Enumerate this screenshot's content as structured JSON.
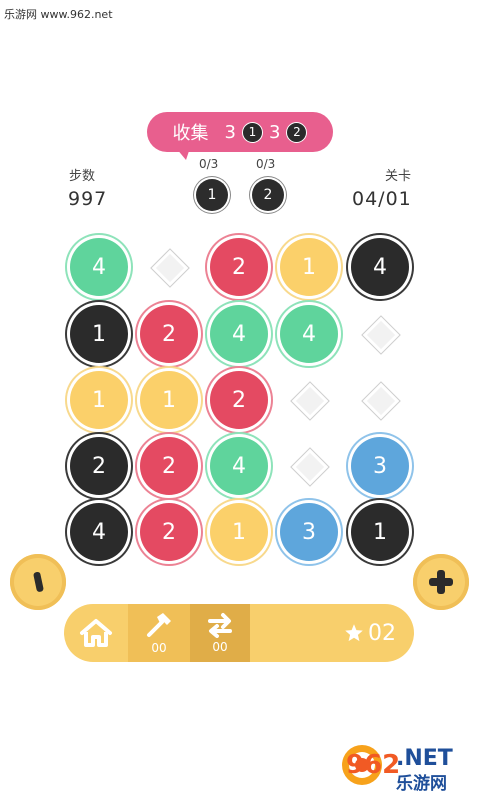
{
  "watermark_top": "乐游网 www.962.net",
  "collect": {
    "label": "收集",
    "items": [
      {
        "count": "3",
        "number": "1"
      },
      {
        "count": "3",
        "number": "2"
      }
    ]
  },
  "steps": {
    "label": "步数",
    "value": "997"
  },
  "level": {
    "label": "关卡",
    "value": "04/01"
  },
  "goals": [
    {
      "progress": "0/3",
      "number": "1"
    },
    {
      "progress": "0/3",
      "number": "2"
    }
  ],
  "board": {
    "rows": [
      [
        {
          "kind": "tile",
          "color": "green",
          "value": "4"
        },
        {
          "kind": "diamond"
        },
        {
          "kind": "tile",
          "color": "red",
          "value": "2"
        },
        {
          "kind": "tile",
          "color": "yellow",
          "value": "1"
        },
        {
          "kind": "tile",
          "color": "black",
          "value": "4"
        }
      ],
      [
        {
          "kind": "tile",
          "color": "black",
          "value": "1"
        },
        {
          "kind": "tile",
          "color": "red",
          "value": "2"
        },
        {
          "kind": "tile",
          "color": "green",
          "value": "4"
        },
        {
          "kind": "tile",
          "color": "green",
          "value": "4"
        },
        {
          "kind": "diamond"
        }
      ],
      [
        {
          "kind": "tile",
          "color": "yellow",
          "value": "1"
        },
        {
          "kind": "tile",
          "color": "yellow",
          "value": "1"
        },
        {
          "kind": "tile",
          "color": "red",
          "value": "2"
        },
        {
          "kind": "diamond"
        },
        {
          "kind": "diamond"
        }
      ],
      [
        {
          "kind": "tile",
          "color": "black",
          "value": "2"
        },
        {
          "kind": "tile",
          "color": "red",
          "value": "2"
        },
        {
          "kind": "tile",
          "color": "green",
          "value": "4"
        },
        {
          "kind": "diamond"
        },
        {
          "kind": "tile",
          "color": "blue",
          "value": "3"
        }
      ],
      [
        {
          "kind": "tile",
          "color": "black",
          "value": "4"
        },
        {
          "kind": "tile",
          "color": "red",
          "value": "2"
        },
        {
          "kind": "tile",
          "color": "yellow",
          "value": "1"
        },
        {
          "kind": "tile",
          "color": "blue",
          "value": "3"
        },
        {
          "kind": "tile",
          "color": "black",
          "value": "1"
        }
      ]
    ]
  },
  "side_left": {
    "icon": "minus-bar-icon"
  },
  "side_right": {
    "icon": "plus-icon"
  },
  "toolbar": {
    "home_icon": "home-icon",
    "hammer_icon": "hammer-icon",
    "hammer_count": "00",
    "swap_icon": "swap-arrows-icon",
    "swap_count": "00",
    "star_icon": "star-icon",
    "stars": "02"
  },
  "logo": {
    "text_top": "962",
    "suffix": ".NET",
    "text_bottom": "乐游网"
  },
  "colors": {
    "black": "#2b2b2b",
    "red": "#e44a62",
    "blue": "#5ea6dc",
    "green": "#5fd49c",
    "yellow": "#fbd06a",
    "pink": "#e85f8e",
    "bar": "#f8cf6c"
  }
}
